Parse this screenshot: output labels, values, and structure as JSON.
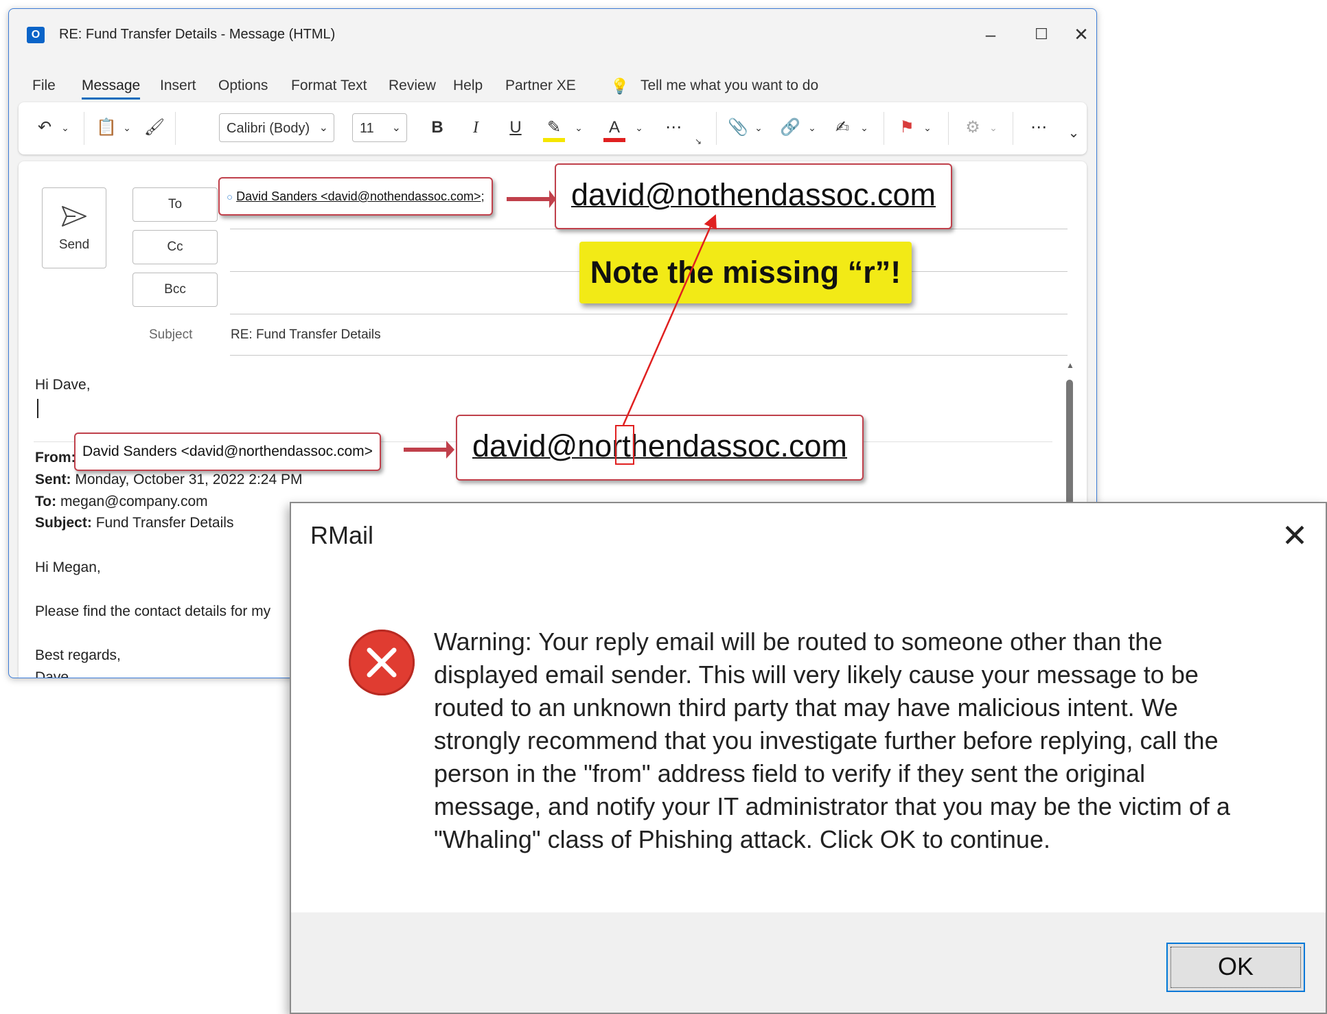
{
  "window": {
    "title": "RE: Fund Transfer Details  -  Message (HTML)",
    "app_icon": "O",
    "controls": {
      "minimize": "–",
      "maximize": "☐",
      "close": "✕"
    }
  },
  "menu": [
    "File",
    "Message",
    "Insert",
    "Options",
    "Format Text",
    "Review",
    "Help",
    "Partner XE"
  ],
  "menu_active": "Message",
  "tell_me": "Tell me what you want to do",
  "ribbon": {
    "font": "Calibri (Body)",
    "size": "11"
  },
  "compose": {
    "send_label": "Send",
    "to_label": "To",
    "cc_label": "Cc",
    "bcc_label": "Bcc",
    "subject_label": "Subject",
    "subject_value": "RE: Fund Transfer Details"
  },
  "body": {
    "greeting": "Hi Dave,",
    "from_label": "From:",
    "from_value": "David Sanders <david@northendassoc.com>",
    "sent_label": "Sent:",
    "sent_value": "Monday, October 31, 2022 2:24 PM",
    "to_label": "To:",
    "to_value": "megan@company.com",
    "subject_label": "Subject:",
    "subject_value": "Fund Transfer Details",
    "orig_greeting": "Hi Megan,",
    "orig_body": "Please find the contact details for my",
    "signoff": "Best regards,",
    "signature": "Dave"
  },
  "annotations": {
    "to_recipient": "David Sanders <david@nothendassoc.com>;",
    "to_domain": "david@nothendassoc.com",
    "note": "Note the missing “r”!",
    "from_recipient": "David Sanders <david@northendassoc.com>",
    "from_domain": "david@northendassoc.com"
  },
  "dialog": {
    "title": "RMail",
    "message": "Warning: Your reply email will be routed to someone other than the displayed email sender. This will very likely cause your message to be routed to an unknown third party that may have malicious intent. We strongly recommend that you investigate further before replying, call the person in the \"from\" address field to verify if they sent the original message, and notify your IT administrator that you may be the victim of a \"Whaling\" class of Phishing attack.  Click OK to continue.",
    "ok_label": "OK",
    "close": "✕"
  },
  "colors": {
    "accent_blue": "#0f6cbd",
    "callout_border": "#c0404b",
    "note_yellow": "#f2ea16",
    "error_red": "#e03c31",
    "arrow_red": "#e02020"
  }
}
